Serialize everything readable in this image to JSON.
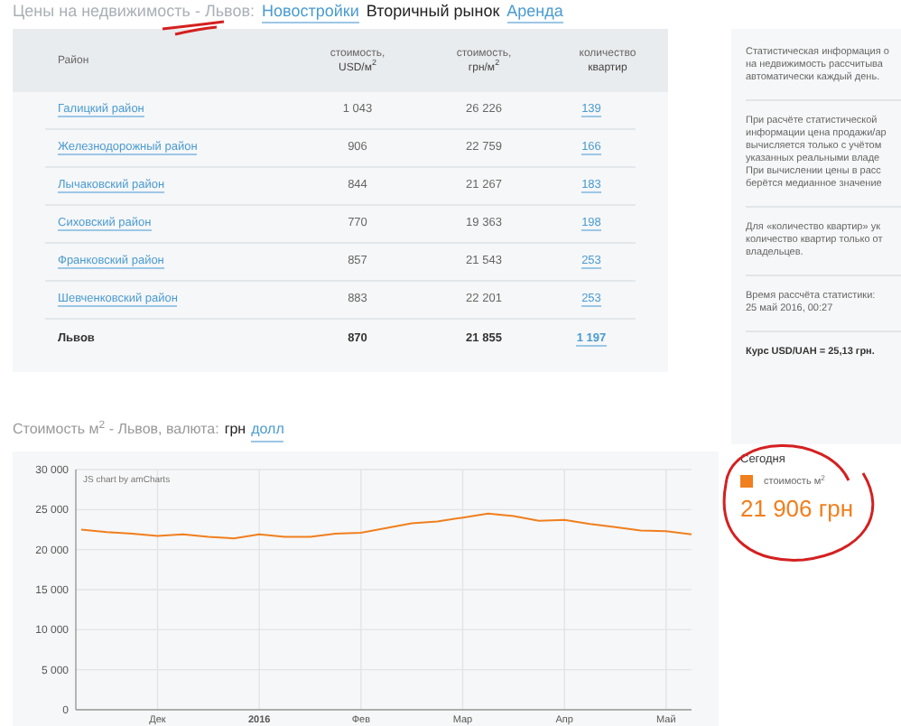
{
  "header": {
    "prefix": "Цены на недвижимость - Львов:",
    "tabs": [
      {
        "label": "Новостройки",
        "selected": false
      },
      {
        "label": "Вторичный рынок",
        "selected": true
      },
      {
        "label": "Аренда",
        "selected": false
      }
    ]
  },
  "table": {
    "columns": [
      {
        "top": "Район"
      },
      {
        "top": "стоимость,",
        "bottom": "USD/м$^{2}$"
      },
      {
        "top": "стоимость,",
        "bottom": "грн/м$^{2}$"
      },
      {
        "top": "количество",
        "bottom": "квартир"
      }
    ],
    "rows": [
      {
        "district": "Галицкий район",
        "usd": "1 043",
        "uah": "26 226",
        "count": "139"
      },
      {
        "district": "Железнодорожный район",
        "usd": "906",
        "uah": "22 759",
        "count": "166"
      },
      {
        "district": "Лычаковский район",
        "usd": "844",
        "uah": "21 267",
        "count": "183"
      },
      {
        "district": "Сиховский район",
        "usd": "770",
        "uah": "19 363",
        "count": "198"
      },
      {
        "district": "Франковский район",
        "usd": "857",
        "uah": "21 543",
        "count": "253"
      },
      {
        "district": "Шевченковский район",
        "usd": "883",
        "uah": "22 201",
        "count": "253"
      }
    ],
    "total": {
      "district": "Львов",
      "usd": "870",
      "uah": "21 855",
      "count": "1 197"
    }
  },
  "info": {
    "sections": [
      [
        "Статистическая информация о",
        "на недвижимость рассчитыва",
        "автоматически каждый день."
      ],
      [
        "При расчёте статистической",
        "информации цена продажи/ар",
        "вычисляется только с учётом",
        "указанных реальными владе",
        "При вычислении цены в расс",
        "берётся медианное значение"
      ],
      [
        "Для «количество квартир» ук",
        "количество квартир только от",
        "владельцев."
      ],
      [
        "Время рассчёта статистики:",
        "25 май 2016, 00:27"
      ]
    ],
    "rate": "Курс USD/UAH = 25,13 грн."
  },
  "chart_section": {
    "title": "Стоимость м$^{2}$ - Львов, валюта:",
    "currencies": [
      {
        "label": "грн",
        "selected": true
      },
      {
        "label": "долл",
        "selected": false
      }
    ],
    "credit": "JS chart by amCharts",
    "chart_data": {
      "type": "line",
      "categories": [
        null,
        null,
        null,
        "Дек",
        null,
        null,
        null,
        "2016",
        null,
        null,
        null,
        "Фев",
        null,
        null,
        null,
        "Мар",
        null,
        null,
        null,
        "Апр",
        null,
        null,
        null,
        "Май",
        null
      ],
      "series": [
        {
          "color": "#f07f1e",
          "values": [
            22500,
            22200,
            22000,
            21700,
            21900,
            21600,
            21400,
            21900,
            21600,
            21600,
            22000,
            22100,
            22700,
            23300,
            23500,
            24000,
            24500,
            24200,
            23600,
            23700,
            23200,
            22800,
            22400,
            22300,
            21900
          ]
        }
      ],
      "ylim": [
        0,
        30000
      ],
      "grid": true,
      "yticks": [
        {
          "value": 0,
          "label": "0"
        },
        {
          "value": 5000,
          "label": "5 000"
        },
        {
          "value": 10000,
          "label": "10 000"
        },
        {
          "value": 15000,
          "label": "15 000"
        },
        {
          "value": 20000,
          "label": "20 000"
        },
        {
          "value": 25000,
          "label": "25 000"
        },
        {
          "value": 30000,
          "label": "30 000"
        }
      ]
    }
  },
  "legend": {
    "title": "Сегодня",
    "series": "стоимость м$^{2}$",
    "color": "#f07f1e",
    "value": "21 906 грн"
  }
}
